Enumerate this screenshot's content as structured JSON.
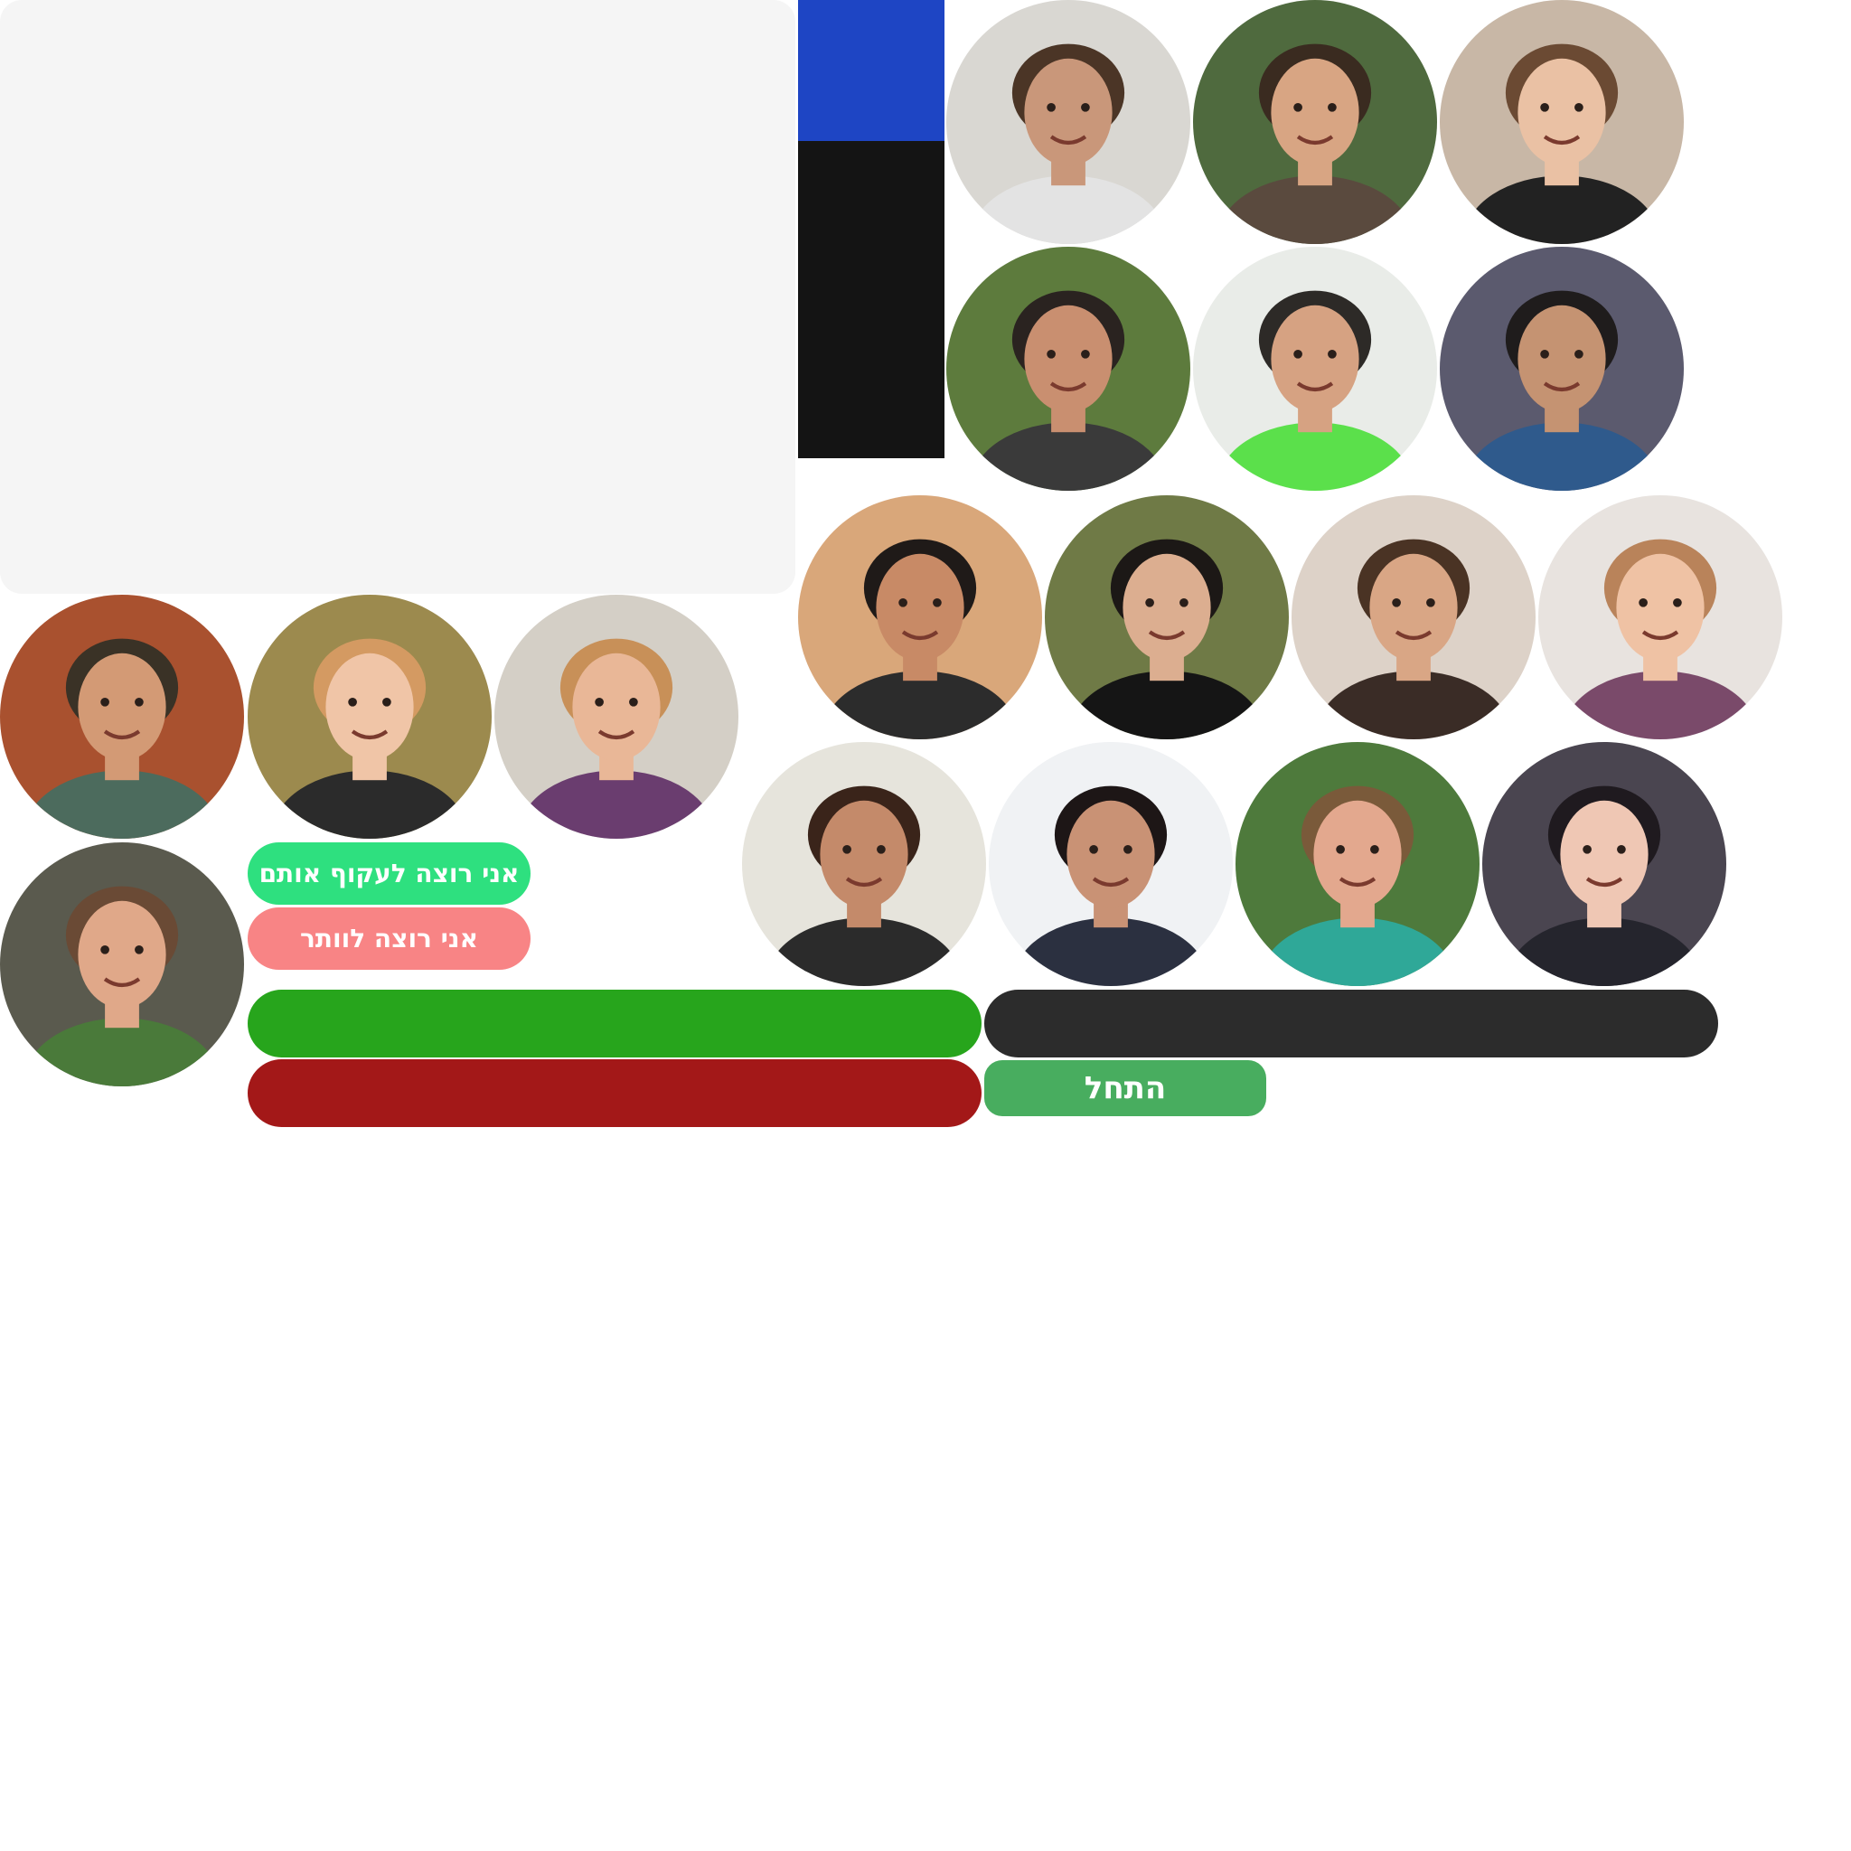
{
  "colors": {
    "panel": "#f5f5f5",
    "blue_block": "#1e45c4",
    "black_block": "#141414",
    "follow_button": "#2ee07f",
    "give_up_button": "#f88485",
    "green_bar": "#27a51c",
    "dark_bar": "#2c2c2c",
    "red_bar": "#a31818",
    "start_button": "#48ad5f"
  },
  "buttons": {
    "follow": "אני רוצה לעקוף אותם",
    "give_up": "אני רוצה לוותר",
    "start": "התחל"
  },
  "avatars": [
    {
      "name": "avatar-1",
      "bg": "#d9d7d2",
      "skin": "#c9977a",
      "hair": "#4b3526",
      "shirt": "#e3e3e3"
    },
    {
      "name": "avatar-2",
      "bg": "#4f6a3e",
      "skin": "#d8a583",
      "hair": "#3a2b20",
      "shirt": "#5a4a3e"
    },
    {
      "name": "avatar-3",
      "bg": "#c8b7a6",
      "skin": "#eac1a4",
      "hair": "#6b4a33",
      "shirt": "#222222"
    },
    {
      "name": "avatar-4",
      "bg": "#5d7b3d",
      "skin": "#c98f70",
      "hair": "#2a2320",
      "shirt": "#3a3a3a"
    },
    {
      "name": "avatar-5",
      "bg": "#e9ece8",
      "skin": "#d6a282",
      "hair": "#2d2a27",
      "shirt": "#5be04b"
    },
    {
      "name": "avatar-6",
      "bg": "#5b5a6e",
      "skin": "#c59372",
      "hair": "#1f1c1c",
      "shirt": "#2f5a8c"
    },
    {
      "name": "avatar-7",
      "bg": "#d9a77a",
      "skin": "#c88a66",
      "hair": "#1f1a18",
      "shirt": "#2c2c2c"
    },
    {
      "name": "avatar-8",
      "bg": "#6f7a46",
      "skin": "#dcae90",
      "hair": "#1c1816",
      "shirt": "#151515"
    },
    {
      "name": "avatar-9",
      "bg": "#ddd2c8",
      "skin": "#d9a685",
      "hair": "#4a3324",
      "shirt": "#3a2c26"
    },
    {
      "name": "avatar-10",
      "bg": "#e8e3df",
      "skin": "#efc2a4",
      "hair": "#b9835a",
      "shirt": "#7a4a6a"
    },
    {
      "name": "avatar-11",
      "bg": "#a9512f",
      "skin": "#d39a75",
      "hair": "#3a3226",
      "shirt": "#4c6b5d"
    },
    {
      "name": "avatar-12",
      "bg": "#9c8a4e",
      "skin": "#f0c5a7",
      "hair": "#d49a62",
      "shirt": "#2b2b2b"
    },
    {
      "name": "avatar-13",
      "bg": "#d4cfc6",
      "skin": "#e9b797",
      "hair": "#c89058",
      "shirt": "#6a3d6f"
    },
    {
      "name": "avatar-14",
      "bg": "#5a5a4e",
      "skin": "#e0a889",
      "hair": "#6a4a35",
      "shirt": "#4a7a3a"
    },
    {
      "name": "avatar-15",
      "bg": "#e6e4dc",
      "skin": "#c48a6a",
      "hair": "#3a241a",
      "shirt": "#2b2b2b"
    },
    {
      "name": "avatar-16",
      "bg": "#f0f2f4",
      "skin": "#c99275",
      "hair": "#1d1616",
      "shirt": "#2b3040"
    },
    {
      "name": "avatar-17",
      "bg": "#4e7a3c",
      "skin": "#e3a88e",
      "hair": "#7a5a3a",
      "shirt": "#2fa898"
    },
    {
      "name": "avatar-18",
      "bg": "#4a4550",
      "skin": "#efc7b4",
      "hair": "#1f1a1f",
      "shirt": "#25252d"
    }
  ]
}
